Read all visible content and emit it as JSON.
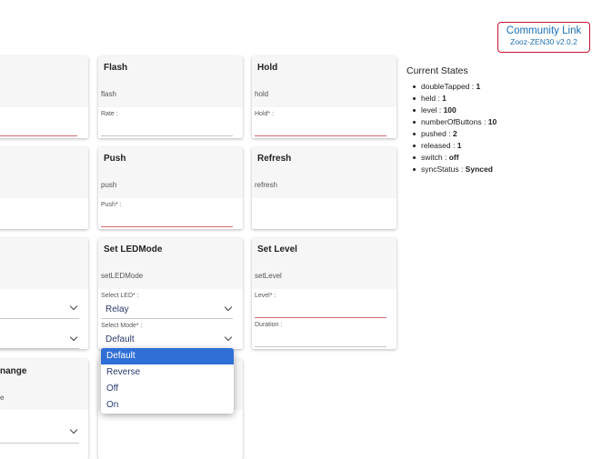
{
  "community": {
    "link_label": "Community Link",
    "version": "Zooz-ZEN30 v2.0.2"
  },
  "states": {
    "title": "Current States",
    "items": [
      {
        "name": "doubleTapped",
        "value": "1"
      },
      {
        "name": "held",
        "value": "1"
      },
      {
        "name": "level",
        "value": "100"
      },
      {
        "name": "numberOfButtons",
        "value": "10"
      },
      {
        "name": "pushed",
        "value": "2"
      },
      {
        "name": "released",
        "value": "1"
      },
      {
        "name": "switch",
        "value": "off"
      },
      {
        "name": "syncStatus",
        "value": "Synced"
      }
    ]
  },
  "cards": {
    "flash": {
      "title": "Flash",
      "command": "flash",
      "field_label": "Rate :"
    },
    "hold": {
      "title": "Hold",
      "command": "hold",
      "field_label": "Hold* :"
    },
    "push": {
      "title": "Push",
      "command": "push",
      "field_label": "Push* :"
    },
    "refresh": {
      "title": "Refresh",
      "command": "refresh"
    },
    "set_led_mode": {
      "title": "Set LEDMode",
      "command": "setLEDMode",
      "led_label": "Select LED* :",
      "led_value": "Relay",
      "mode_label": "Select Mode* :",
      "mode_value": "Default"
    },
    "set_level": {
      "title": "Set Level",
      "command": "setLevel",
      "level_label": "Level* :",
      "duration_label": "Duration :"
    },
    "partial_bottom": {
      "title_fragment": "nange",
      "cmd_fragment": "e"
    }
  },
  "mode_dropdown": {
    "options": [
      "Default",
      "Reverse",
      "Off",
      "On"
    ],
    "selected": "Default"
  }
}
